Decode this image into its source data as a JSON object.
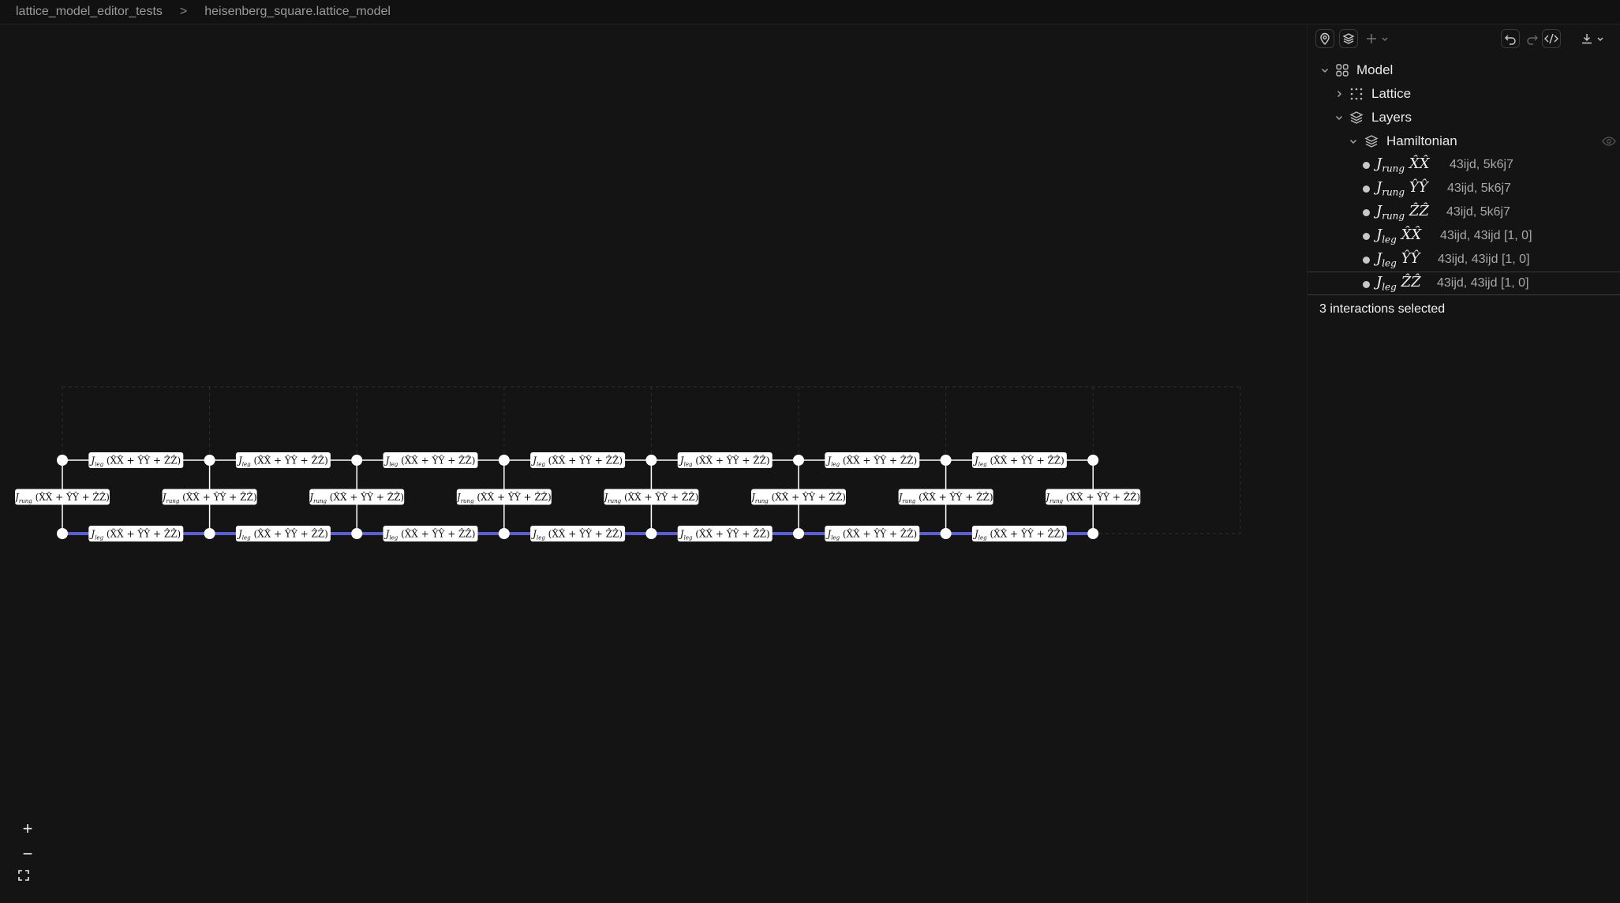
{
  "breadcrumb": {
    "project": "lattice_model_editor_tests",
    "separator": ">",
    "file": "heisenberg_square.lattice_model"
  },
  "toolbar": {
    "icons": [
      "location-pin-icon",
      "layers-icon",
      "plus-icon",
      "chevron-down-icon",
      "undo-icon",
      "redo-icon",
      "code-icon",
      "download-icon",
      "chevron-down-icon"
    ]
  },
  "tree": {
    "model": "Model",
    "lattice": "Lattice",
    "layers": "Layers",
    "hamiltonian": "Hamiltonian",
    "terms": [
      {
        "coef": "J",
        "sub": "rung",
        "op": "X̂X̂",
        "sites": "43ijd, 5k6j7"
      },
      {
        "coef": "J",
        "sub": "rung",
        "op": "ŶŶ",
        "sites": "43ijd, 5k6j7"
      },
      {
        "coef": "J",
        "sub": "rung",
        "op": "ẐẐ",
        "sites": "43ijd, 5k6j7"
      },
      {
        "coef": "J",
        "sub": "leg",
        "op": "X̂X̂",
        "sites": "43ijd, 43ijd [1, 0]"
      },
      {
        "coef": "J",
        "sub": "leg",
        "op": "ŶŶ",
        "sites": "43ijd, 43ijd [1, 0]"
      },
      {
        "coef": "J",
        "sub": "leg",
        "op": "ẐẐ",
        "sites": "43ijd, 43ijd [1, 0]"
      }
    ]
  },
  "status": "3 interactions selected",
  "lattice_view": {
    "cells": 8,
    "leg_label": "J_leg (X̂X̂ + ŶŶ + ẐẐ)",
    "rung_label": "J_rung (X̂X̂ + ŶŶ + ẐẐ)",
    "leg_coef": "J",
    "leg_sub": "leg",
    "rung_coef": "J",
    "rung_sub": "rung",
    "operator": "(X̂X̂ + ŶŶ + ẐẐ)",
    "highlight_color": "#5b5fd6",
    "bond_color": "#ffffff"
  },
  "zoom": {
    "in": "+",
    "out": "−",
    "fit": "fit-screen-icon"
  }
}
